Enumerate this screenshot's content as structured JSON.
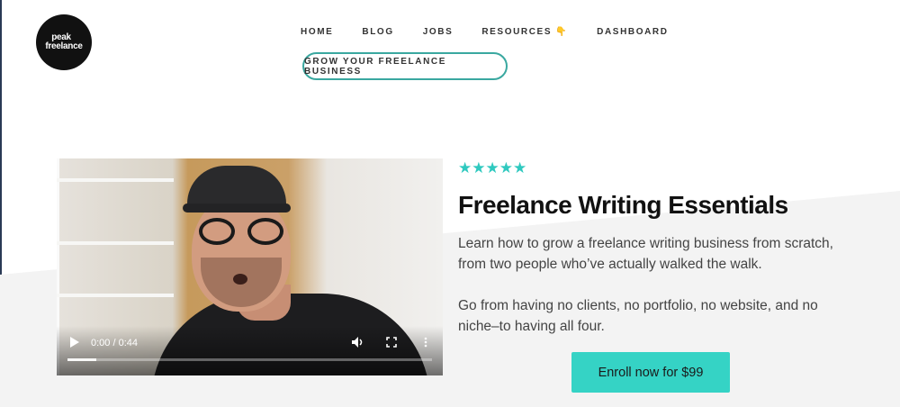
{
  "logo": {
    "line1": "peak",
    "line2": "freelance"
  },
  "nav": {
    "items": [
      {
        "label": "HOME"
      },
      {
        "label": "BLOG"
      },
      {
        "label": "JOBS"
      },
      {
        "label": "RESOURCES",
        "icon": "hand-pointing-down-icon",
        "glyph": "👇"
      },
      {
        "label": "DASHBOARD"
      }
    ]
  },
  "cta": {
    "label": "GROW YOUR FREELANCE BUSINESS"
  },
  "video": {
    "time": "0:00 / 0:44",
    "progress_fraction": 0.08,
    "icons": {
      "play": "play-icon",
      "volume": "volume-icon",
      "fullscreen": "fullscreen-icon",
      "more": "more-options-icon"
    }
  },
  "course": {
    "rating_stars": 5,
    "star_glyph": "★",
    "star_color": "#2fc9bf",
    "title": "Freelance Writing Essentials",
    "description1": "Learn how to grow a freelance writing business from scratch, from two people who’ve actually walked the walk.",
    "description2": "Go from having no clients, no portfolio, no website, and no niche–to having all four.",
    "enroll_label": "Enroll now for $99",
    "accent_color": "#35d3c5"
  }
}
